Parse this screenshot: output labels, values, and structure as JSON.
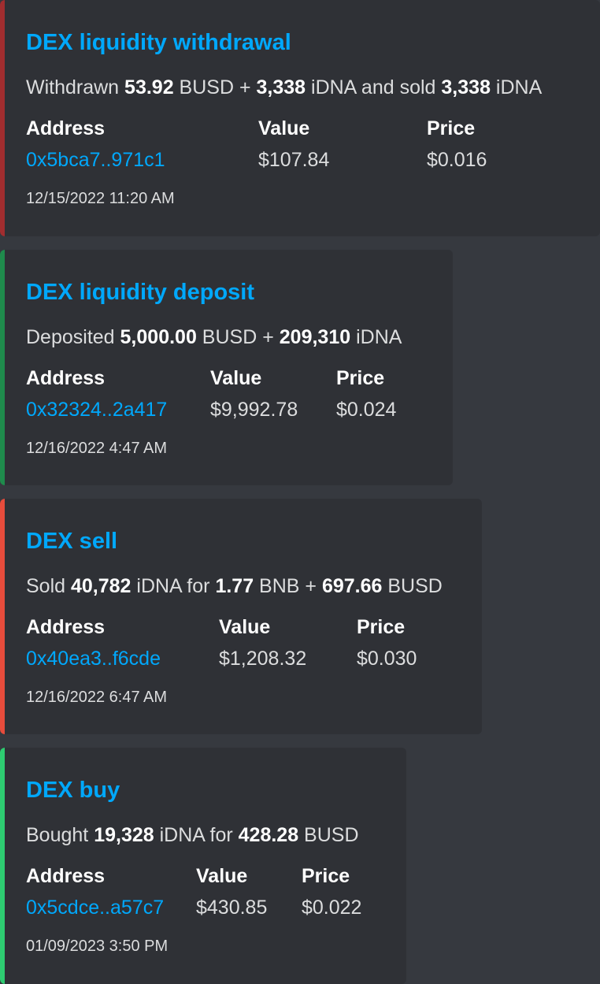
{
  "cards": [
    {
      "title": "DEX liquidity withdrawal",
      "accent_color": "#a12d2f",
      "description": [
        {
          "text": "Withdrawn ",
          "bold": false
        },
        {
          "text": "53.92",
          "bold": true
        },
        {
          "text": " BUSD + ",
          "bold": false
        },
        {
          "text": "3,338",
          "bold": true
        },
        {
          "text": " iDNA and sold ",
          "bold": false
        },
        {
          "text": "3,338",
          "bold": true
        },
        {
          "text": " iDNA",
          "bold": false
        }
      ],
      "fields": [
        {
          "name": "Address",
          "value": "0x5bca7..971c1",
          "link": true
        },
        {
          "name": "Value",
          "value": "$107.84",
          "link": false
        },
        {
          "name": "Price",
          "value": "$0.016",
          "link": false
        }
      ],
      "timestamp": "12/15/2022 11:20 AM"
    },
    {
      "title": "DEX liquidity deposit",
      "accent_color": "#1f8b4c",
      "description": [
        {
          "text": "Deposited ",
          "bold": false
        },
        {
          "text": "5,000.00",
          "bold": true
        },
        {
          "text": " BUSD + ",
          "bold": false
        },
        {
          "text": "209,310",
          "bold": true
        },
        {
          "text": " iDNA",
          "bold": false
        }
      ],
      "fields": [
        {
          "name": "Address",
          "value": "0x32324..2a417",
          "link": true
        },
        {
          "name": "Value",
          "value": "$9,992.78",
          "link": false
        },
        {
          "name": "Price",
          "value": "$0.024",
          "link": false
        }
      ],
      "timestamp": "12/16/2022 4:47 AM"
    },
    {
      "title": "DEX sell",
      "accent_color": "#e74c3c",
      "description": [
        {
          "text": "Sold ",
          "bold": false
        },
        {
          "text": "40,782",
          "bold": true
        },
        {
          "text": " iDNA for ",
          "bold": false
        },
        {
          "text": "1.77",
          "bold": true
        },
        {
          "text": " BNB + ",
          "bold": false
        },
        {
          "text": "697.66",
          "bold": true
        },
        {
          "text": " BUSD",
          "bold": false
        }
      ],
      "fields": [
        {
          "name": "Address",
          "value": "0x40ea3..f6cde",
          "link": true
        },
        {
          "name": "Value",
          "value": "$1,208.32",
          "link": false
        },
        {
          "name": "Price",
          "value": "$0.030",
          "link": false
        }
      ],
      "timestamp": "12/16/2022 6:47 AM"
    },
    {
      "title": "DEX buy",
      "accent_color": "#2ecc71",
      "description": [
        {
          "text": "Bought ",
          "bold": false
        },
        {
          "text": "19,328",
          "bold": true
        },
        {
          "text": " iDNA for ",
          "bold": false
        },
        {
          "text": "428.28",
          "bold": true
        },
        {
          "text": " BUSD",
          "bold": false
        }
      ],
      "fields": [
        {
          "name": "Address",
          "value": "0x5cdce..a57c7",
          "link": true
        },
        {
          "name": "Value",
          "value": "$430.85",
          "link": false
        },
        {
          "name": "Price",
          "value": "$0.022",
          "link": false
        }
      ],
      "timestamp": "01/09/2023 3:50 PM"
    }
  ]
}
